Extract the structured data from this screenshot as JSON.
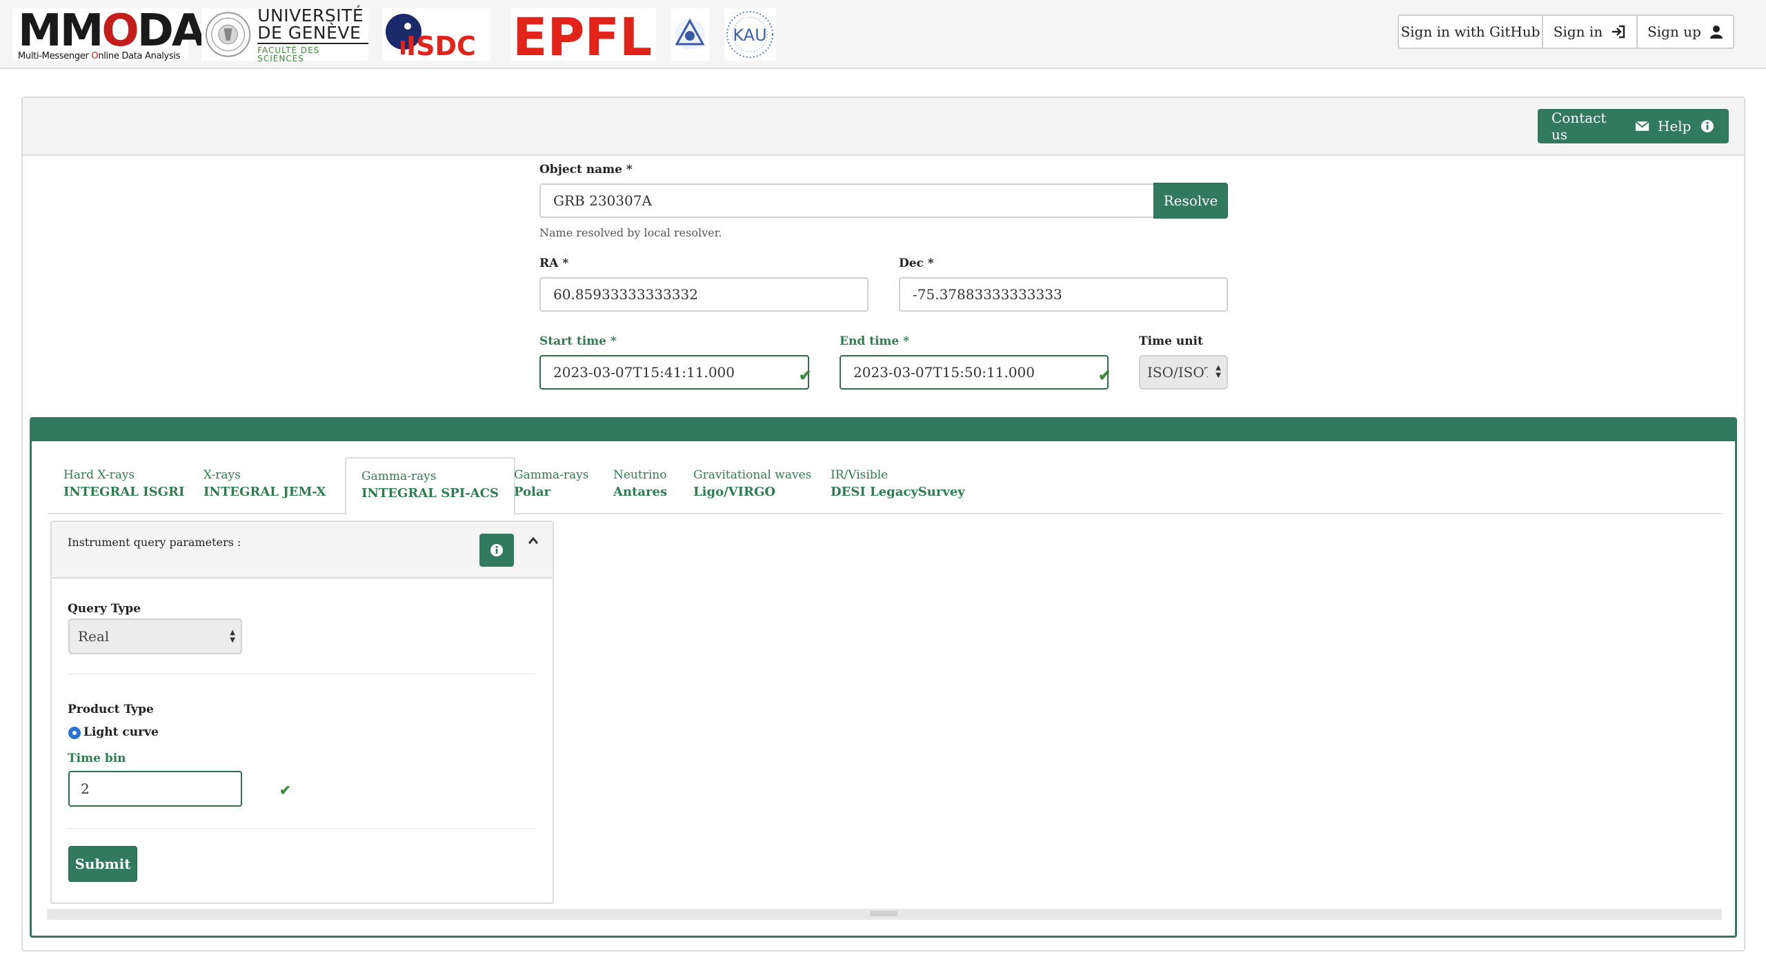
{
  "header": {
    "logos": {
      "mmoda_title_pre": "MM",
      "mmoda_title_o": "O",
      "mmoda_title_post": "DA",
      "mmoda_subtitle_a": "Multi-Messenger ",
      "mmoda_subtitle_r": "O",
      "mmoda_subtitle_b": "nline Data Analysis",
      "unige_line1": "UNIVERSITÉ",
      "unige_line2": "DE GENÈVE",
      "unige_line3": "FACULTÉ DES SCIENCES",
      "isdc": "ISDC",
      "epfl": "EPFL",
      "kau": "KAU"
    },
    "auth": {
      "github": "Sign in with GitHub",
      "signin": "Sign in",
      "signup": "Sign up"
    }
  },
  "panel": {
    "contact": "Contact us",
    "help": "Help"
  },
  "form": {
    "object_label": "Object name *",
    "object_value": "GRB 230307A",
    "resolve": "Resolve",
    "resolve_note": "Name resolved by local resolver.",
    "ra_label": "RA *",
    "ra_value": "60.85933333333332",
    "dec_label": "Dec *",
    "dec_value": "-75.37883333333333",
    "start_label": "Start time *",
    "start_value": "2023-03-07T15:41:11.000",
    "end_label": "End time *",
    "end_value": "2023-03-07T15:50:11.000",
    "unit_label": "Time unit",
    "unit_value": "ISO/ISOT"
  },
  "tabs": [
    {
      "small": "Hard X-rays",
      "big": "INTEGRAL ISGRI"
    },
    {
      "small": "X-rays",
      "big": "INTEGRAL JEM-X"
    },
    {
      "small": "Gamma-rays",
      "big": "INTEGRAL SPI-ACS"
    },
    {
      "small": "Gamma-rays",
      "big": "Polar"
    },
    {
      "small": "Neutrino",
      "big": "Antares"
    },
    {
      "small": "Gravitational waves",
      "big": "Ligo/VIRGO"
    },
    {
      "small": "IR/Visible",
      "big": "DESI LegacySurvey"
    }
  ],
  "active_tab_index": 2,
  "query": {
    "title": "Instrument query parameters :",
    "query_type_label": "Query Type",
    "query_type_value": "Real",
    "product_type_label": "Product Type",
    "product_option": "Light curve",
    "time_bin_label": "Time bin",
    "time_bin_value": "2",
    "submit": "Submit"
  },
  "colors": {
    "accent": "#317a60",
    "valid_text": "#2e7d4f",
    "radio": "#2a73d6",
    "brand_red": "#c51c1c",
    "epfl_red": "#e2231a",
    "isdc_blue": "#1b2a6b"
  }
}
